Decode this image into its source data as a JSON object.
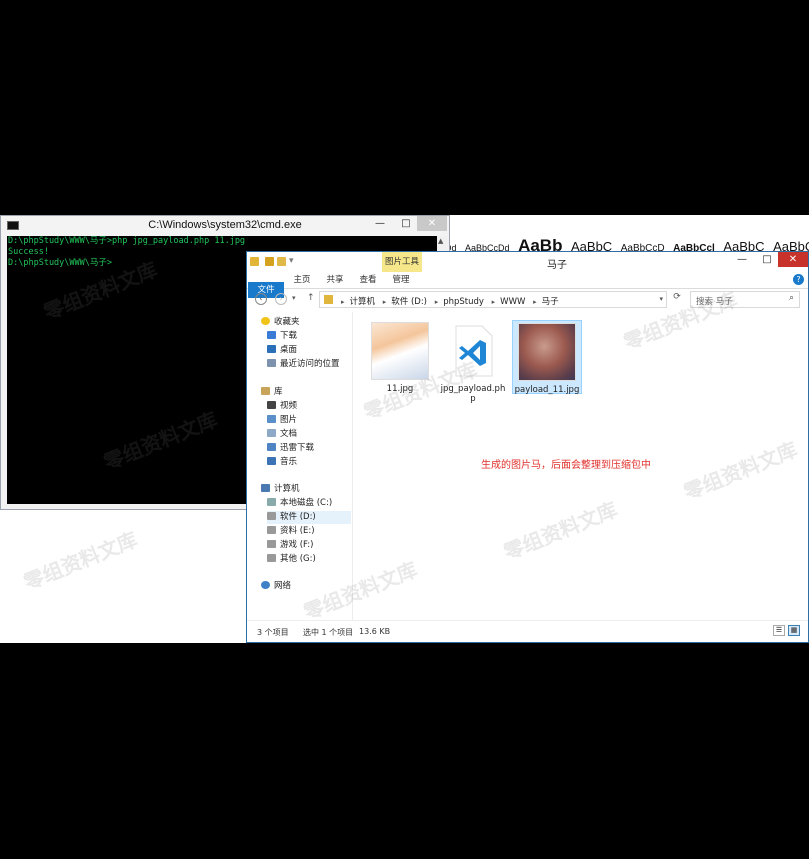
{
  "word_ribbon": {
    "styles": [
      "Dd",
      "AaBbCcDd",
      "AaBb",
      "AaBbC",
      "AaBbCcD",
      "AaBbCcl",
      "AaBbC",
      "AaBbCc"
    ]
  },
  "cmd": {
    "title": "C:\\Windows\\system32\\cmd.exe",
    "lines": [
      "D:\\phpStudy\\WWW\\马子>php jpg_payload.php 11.jpg",
      "Success!",
      "D:\\phpStudy\\WWW\\马子>"
    ],
    "text_color": "#22c45a"
  },
  "explorer": {
    "title": "马子",
    "context_tab": "图片工具",
    "tabs": [
      "文件",
      "主页",
      "共享",
      "查看",
      "管理"
    ],
    "breadcrumb": [
      "计算机",
      "软件 (D:)",
      "phpStudy",
      "WWW",
      "马子"
    ],
    "search_placeholder": "搜索 马子",
    "nav": {
      "favorites_label": "收藏夹",
      "favorites": [
        "下载",
        "桌面",
        "最近访问的位置"
      ],
      "libraries_label": "库",
      "libraries": [
        "视频",
        "图片",
        "文档",
        "迅雷下载",
        "音乐"
      ],
      "computer_label": "计算机",
      "drives": [
        "本地磁盘 (C:)",
        "软件 (D:)",
        "资料 (E:)",
        "游戏 (F:)",
        "其他 (G:)"
      ],
      "network_label": "网络"
    },
    "files": [
      {
        "name": "11.jpg",
        "icon": "image-thumbnail"
      },
      {
        "name": "jpg_payload.php",
        "icon": "vscode-icon"
      },
      {
        "name": "payload_11.jpg",
        "icon": "image-thumbnail",
        "selected": true
      }
    ],
    "note": "生成的图片马，后面会整理到压缩包中",
    "status": {
      "count": "3 个项目",
      "selected": "选中 1 个项目",
      "size": "13.6 KB"
    },
    "accent": "#1979ca"
  },
  "watermark": "零组资料文库"
}
